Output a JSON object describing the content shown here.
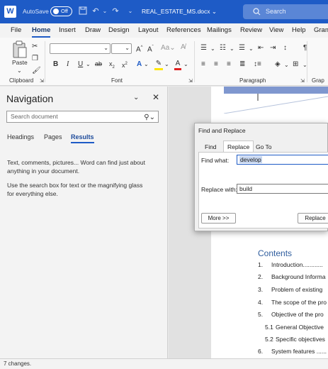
{
  "titlebar": {
    "logo": "W",
    "autosave_label": "AutoSave",
    "autosave_state": "Off",
    "filename": "REAL_ESTATE_MS.docx",
    "filename_chevron": "⌄",
    "search_placeholder": "Search"
  },
  "tabs": [
    "File",
    "Home",
    "Insert",
    "Draw",
    "Design",
    "Layout",
    "References",
    "Mailings",
    "Review",
    "View",
    "Help",
    "Gram"
  ],
  "ribbon": {
    "clipboard_label": "Clipboard",
    "paste_label": "Paste",
    "font_label": "Font",
    "paragraph_label": "Paragraph",
    "styles_partial_label": "Grap",
    "font_name": "",
    "font_size": ""
  },
  "navigation": {
    "title": "Navigation",
    "search_placeholder": "Search document",
    "tabs": [
      "Headings",
      "Pages",
      "Results"
    ],
    "active_tab": "Results",
    "message1": "Text, comments, pictures... Word can find just about anything in your document.",
    "message2": "Use the search box for text or the magnifying glass for everything else."
  },
  "dialog": {
    "title": "Find and Replace",
    "tabs": [
      "Find",
      "Replace",
      "Go To"
    ],
    "active_tab": "Replace",
    "find_label": "Find what:",
    "find_value": "develop",
    "replace_label": "Replace with:",
    "replace_value": "build",
    "more_button": "More >>",
    "replace_button": "Replace"
  },
  "document": {
    "toc_title": "Contents",
    "toc_items": [
      {
        "num": "1.",
        "text": "Introduction............"
      },
      {
        "num": "2.",
        "text": "Background Informa"
      },
      {
        "num": "3.",
        "text": "Problem of existing"
      },
      {
        "num": "4.",
        "text": "The scope of the pro"
      },
      {
        "num": "5.",
        "text": "Objective of the pro"
      },
      {
        "num": "5.1",
        "text": "General Objective"
      },
      {
        "num": "5.2",
        "text": "Specific objectives"
      },
      {
        "num": "6.",
        "text": "System features ......"
      }
    ]
  },
  "status": {
    "text": "7 changes."
  },
  "colors": {
    "accent": "#1e5bc6",
    "toc_heading": "#2f5d9e"
  }
}
